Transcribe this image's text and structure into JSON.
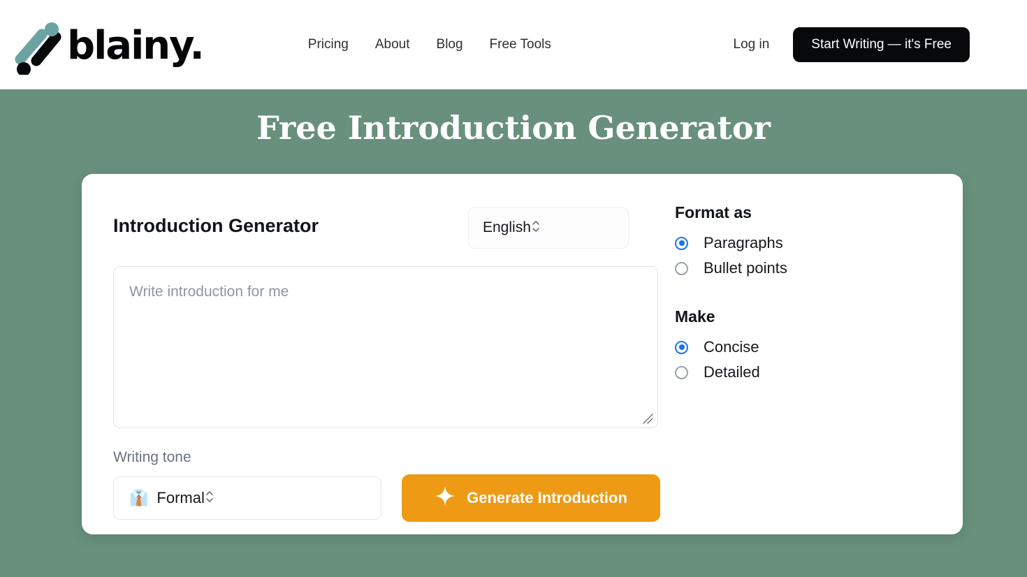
{
  "header": {
    "brand_word": "blainy.",
    "nav": [
      {
        "label": "Pricing"
      },
      {
        "label": "About"
      },
      {
        "label": "Blog"
      },
      {
        "label": "Free Tools"
      }
    ],
    "login_label": "Log in",
    "cta_label": "Start Writing — it's Free"
  },
  "hero": {
    "title": "Free Introduction Generator",
    "background_color": "#68907c"
  },
  "card": {
    "tool_title": "Introduction Generator",
    "language": {
      "value": "English"
    },
    "prompt": {
      "value": "",
      "placeholder": "Write introduction for me"
    },
    "tone": {
      "label": "Writing tone",
      "emoji": "👔",
      "value": "Formal"
    },
    "generate_label": "Generate Introduction",
    "generate_color": "#ef9a14"
  },
  "options": {
    "format": {
      "title": "Format as",
      "choices": [
        {
          "label": "Paragraphs",
          "selected": true
        },
        {
          "label": "Bullet points",
          "selected": false
        }
      ]
    },
    "make": {
      "title": "Make",
      "choices": [
        {
          "label": "Concise",
          "selected": true
        },
        {
          "label": "Detailed",
          "selected": false
        }
      ]
    }
  },
  "accent_colors": {
    "radio_selected": "#1a73e8",
    "brand_teal": "#6ba3a3",
    "brand_black": "#08090b"
  }
}
